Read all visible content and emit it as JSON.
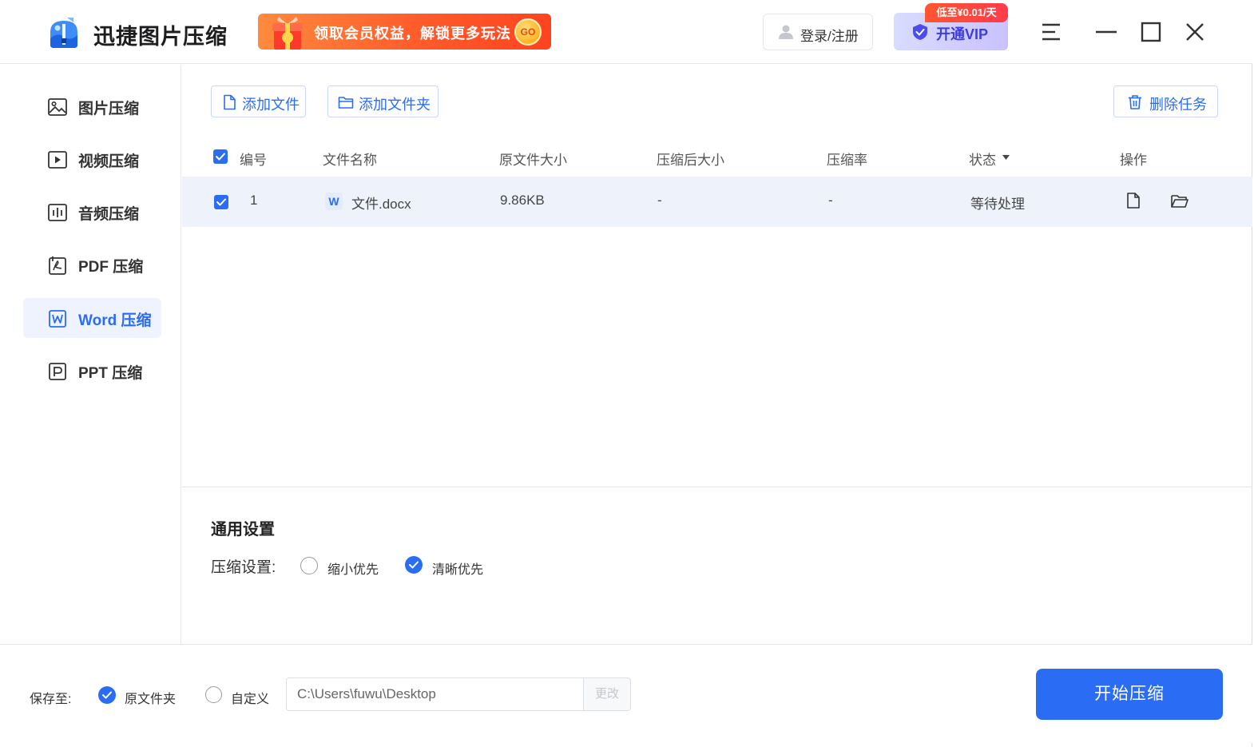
{
  "app": {
    "name": "迅捷图片压缩",
    "promo_text": "领取会员权益，解锁更多玩法",
    "promo_go": "GO",
    "login_label": "登录/注册",
    "vip_label": "开通VIP",
    "vip_badge": "低至¥0.01/天"
  },
  "sidebar": {
    "items": [
      {
        "label": "图片压缩",
        "icon": "image-icon"
      },
      {
        "label": "视频压缩",
        "icon": "video-icon"
      },
      {
        "label": "音频压缩",
        "icon": "audio-icon"
      },
      {
        "label": "PDF 压缩",
        "icon": "pdf-icon"
      },
      {
        "label": "Word 压缩",
        "icon": "word-icon",
        "active": true
      },
      {
        "label": "PPT 压缩",
        "icon": "ppt-icon"
      }
    ]
  },
  "toolbar": {
    "add_file": "添加文件",
    "add_folder": "添加文件夹",
    "delete_task": "删除任务"
  },
  "table": {
    "columns": [
      "编号",
      "文件名称",
      "原文件大小",
      "压缩后大小",
      "压缩率",
      "状态",
      "操作"
    ],
    "rows": [
      {
        "index": "1",
        "file_icon": "W",
        "name": "文件.docx",
        "original_size": "9.86KB",
        "compressed_size": "-",
        "ratio": "-",
        "status": "等待处理"
      }
    ]
  },
  "settings": {
    "title": "通用设置",
    "compress_label": "压缩设置:",
    "options": [
      "缩小优先",
      "清晰优先"
    ],
    "selected": "清晰优先"
  },
  "save": {
    "label": "保存至:",
    "options": [
      "原文件夹",
      "自定义"
    ],
    "selected": "原文件夹",
    "path_value": "C:\\Users\\fuwu\\Desktop",
    "change_label": "更改",
    "start_label": "开始压缩"
  },
  "colors": {
    "accent": "#2a6df4",
    "row_highlight": "#eef3fb",
    "promo": "#ff5b2b"
  }
}
